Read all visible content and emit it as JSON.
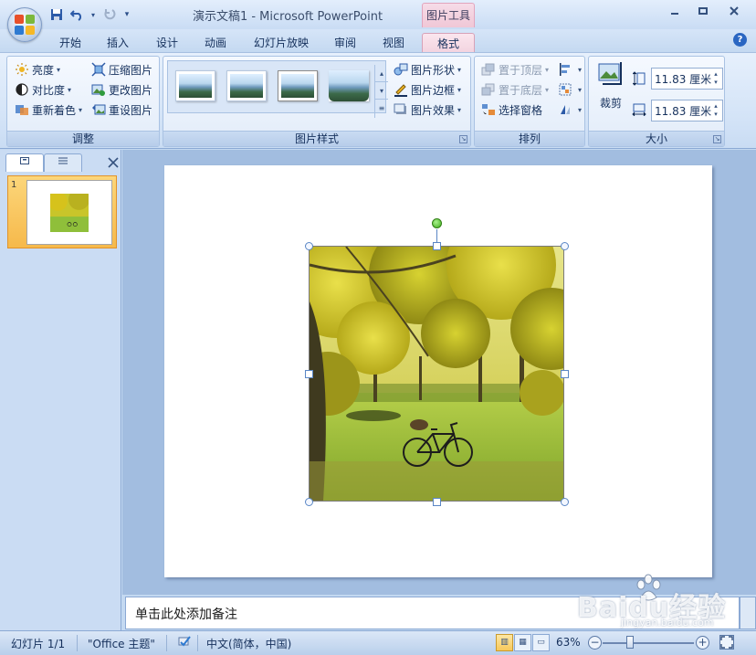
{
  "window": {
    "title": "演示文稿1 - Microsoft PowerPoint",
    "contextual_tools": "图片工具"
  },
  "tabs": [
    {
      "label": "开始"
    },
    {
      "label": "插入"
    },
    {
      "label": "设计"
    },
    {
      "label": "动画"
    },
    {
      "label": "幻灯片放映"
    },
    {
      "label": "审阅"
    },
    {
      "label": "视图"
    },
    {
      "label": "格式",
      "active": true
    }
  ],
  "ribbon": {
    "adjust": {
      "label": "调整",
      "brightness": "亮度",
      "contrast": "对比度",
      "recolor": "重新着色",
      "compress": "压缩图片",
      "change_picture": "更改图片",
      "reset_picture": "重设图片"
    },
    "styles": {
      "label": "图片样式",
      "shape": "图片形状",
      "border": "图片边框",
      "effects": "图片效果"
    },
    "arrange": {
      "label": "排列",
      "bring_front": "置于顶层",
      "send_back": "置于底层",
      "selection_pane": "选择窗格"
    },
    "size": {
      "label": "大小",
      "crop": "裁剪",
      "height": "11.83 厘米",
      "width": "11.83 厘米"
    }
  },
  "slides_pane": {
    "slide_number": "1"
  },
  "notes": {
    "placeholder": "单击此处添加备注"
  },
  "status": {
    "slide": "幻灯片 1/1",
    "theme": "\"Office 主题\"",
    "language": "中文(简体，中国)",
    "zoom": "63%"
  },
  "watermark": {
    "brand": "Baidu经验",
    "url": "jingyan.baidu.com"
  },
  "colors": {
    "accent_tab": "#f3d4e0",
    "ribbon": "#dbe7f7",
    "selection_handle": "#5a86c5",
    "rotate_handle": "#3fae1b"
  }
}
